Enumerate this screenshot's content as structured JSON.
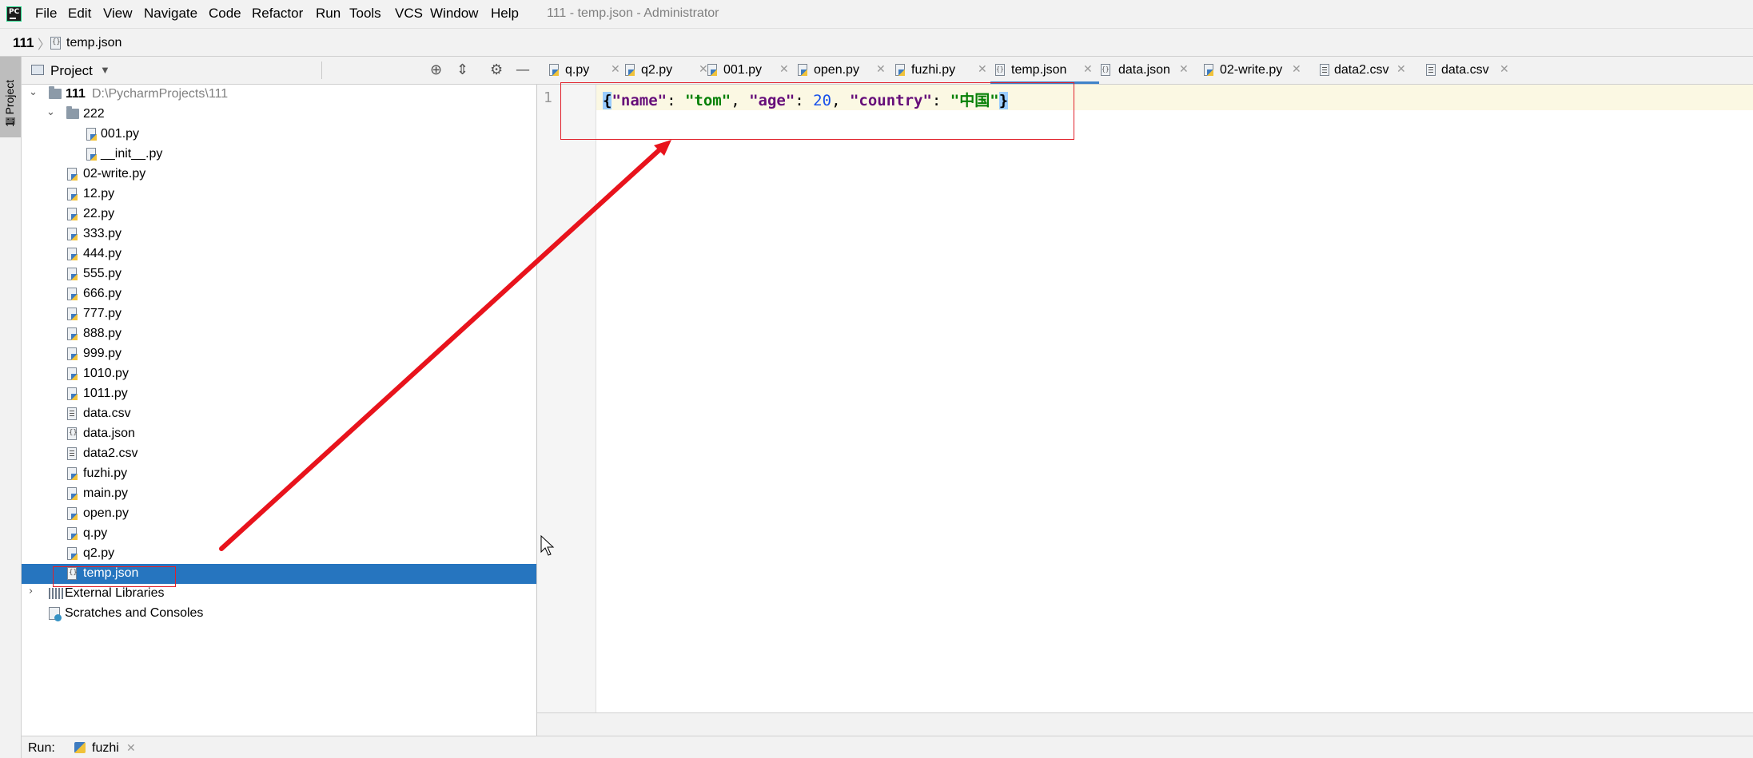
{
  "app": {
    "window_title": "111 - temp.json - Administrator",
    "menu": [
      "File",
      "Edit",
      "View",
      "Navigate",
      "Code",
      "Refactor",
      "Run",
      "Tools",
      "VCS",
      "Window",
      "Help"
    ]
  },
  "breadcrumb": {
    "root": "111",
    "file": "temp.json"
  },
  "left_strip": {
    "tab_label": "1: Project"
  },
  "project_panel": {
    "title": "Project",
    "root": {
      "name": "111",
      "path": "D:\\PycharmProjects\\111"
    },
    "folder_222": {
      "name": "222",
      "children": [
        "001.py",
        "__init__.py"
      ]
    },
    "files": [
      {
        "name": "02-write.py",
        "type": "py"
      },
      {
        "name": "12.py",
        "type": "py"
      },
      {
        "name": "22.py",
        "type": "py"
      },
      {
        "name": "333.py",
        "type": "py"
      },
      {
        "name": "444.py",
        "type": "py"
      },
      {
        "name": "555.py",
        "type": "py"
      },
      {
        "name": "666.py",
        "type": "py"
      },
      {
        "name": "777.py",
        "type": "py"
      },
      {
        "name": "888.py",
        "type": "py"
      },
      {
        "name": "999.py",
        "type": "py"
      },
      {
        "name": "1010.py",
        "type": "py"
      },
      {
        "name": "1011.py",
        "type": "py"
      },
      {
        "name": "data.csv",
        "type": "csv"
      },
      {
        "name": "data.json",
        "type": "json"
      },
      {
        "name": "data2.csv",
        "type": "csv"
      },
      {
        "name": "fuzhi.py",
        "type": "py"
      },
      {
        "name": "main.py",
        "type": "py"
      },
      {
        "name": "open.py",
        "type": "py"
      },
      {
        "name": "q.py",
        "type": "py"
      },
      {
        "name": "q2.py",
        "type": "py"
      },
      {
        "name": "temp.json",
        "type": "json",
        "selected": true
      }
    ],
    "external_libraries": "External Libraries",
    "scratches": "Scratches and Consoles"
  },
  "editor": {
    "tabs": [
      {
        "label": "q.py",
        "type": "py"
      },
      {
        "label": "q2.py",
        "type": "py"
      },
      {
        "label": "001.py",
        "type": "py"
      },
      {
        "label": "open.py",
        "type": "py"
      },
      {
        "label": "fuzhi.py",
        "type": "py"
      },
      {
        "label": "temp.json",
        "type": "json",
        "active": true
      },
      {
        "label": "data.json",
        "type": "json"
      },
      {
        "label": "02-write.py",
        "type": "py"
      },
      {
        "label": "data2.csv",
        "type": "csv"
      },
      {
        "label": "data.csv",
        "type": "csv"
      }
    ],
    "line_number": "1",
    "code": {
      "open_brace": "{",
      "key1": "\"name\"",
      "colon1": ": ",
      "val1": "\"tom\"",
      "comma1": ", ",
      "key2": "\"age\"",
      "colon2": ": ",
      "val2": "20",
      "comma2": ", ",
      "key3": "\"country\"",
      "colon3": ": ",
      "val3": "\"中国\"",
      "close_brace": "}"
    }
  },
  "run_bar": {
    "label": "Run:",
    "config": "fuzhi"
  },
  "colors": {
    "selection": "#2675bf",
    "annotation_red": "#e0202a",
    "active_tab_underline": "#4083c9"
  }
}
